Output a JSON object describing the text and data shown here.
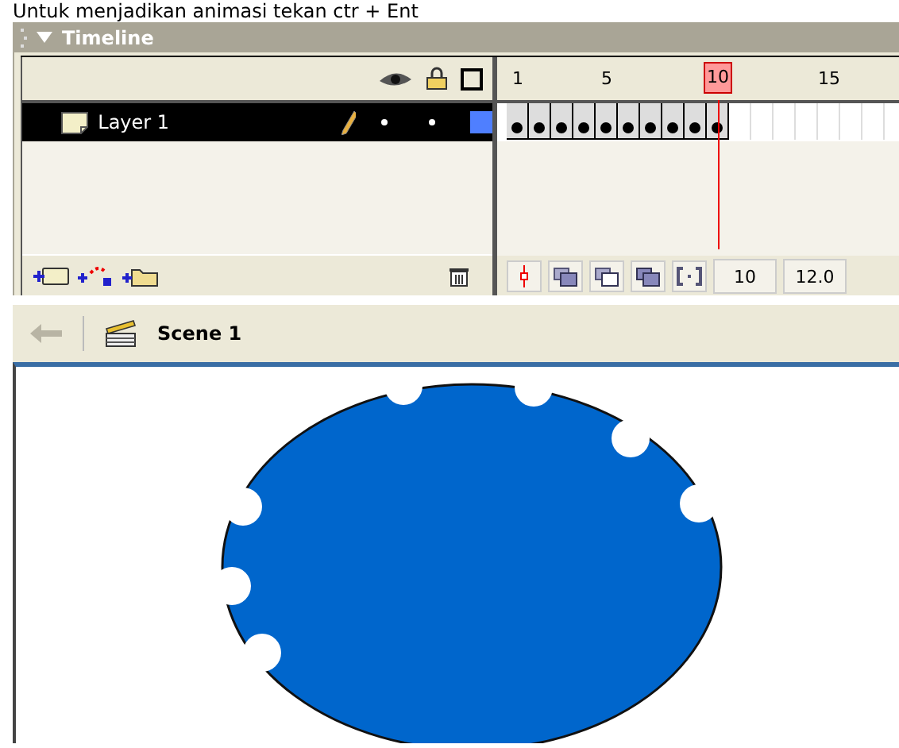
{
  "caption": "Untuk menjadikan animasi tekan ctr + Ent",
  "timeline": {
    "title": "Timeline",
    "expanded": true,
    "ruler": [
      {
        "label": "1"
      },
      {
        "label": "5"
      },
      {
        "label": "10"
      },
      {
        "label": "15"
      }
    ],
    "current_frame": "10",
    "frame_rate": "12.0",
    "layers": [
      {
        "name": "Layer 1",
        "selected": true,
        "editing": true,
        "color": "#4f7fff",
        "frames": [
          {
            "kind": "keyframe"
          },
          {
            "kind": "keyframe"
          },
          {
            "kind": "keyframe"
          },
          {
            "kind": "keyframe"
          },
          {
            "kind": "keyframe"
          },
          {
            "kind": "keyframe"
          },
          {
            "kind": "keyframe"
          },
          {
            "kind": "keyframe"
          },
          {
            "kind": "keyframe"
          },
          {
            "kind": "keyframe"
          }
        ]
      }
    ]
  },
  "scene_bar": {
    "back_disabled": true,
    "scene": "Scene 1"
  },
  "stage": {
    "shapes": [
      {
        "kind": "bitten-circle",
        "color": "#0066cc"
      }
    ]
  }
}
